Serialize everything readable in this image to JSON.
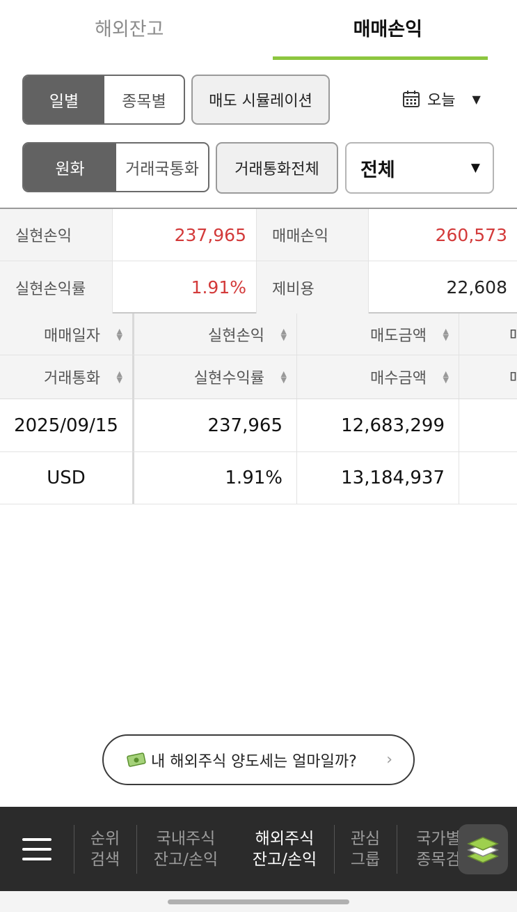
{
  "top_tabs": [
    {
      "label": "해외잔고"
    },
    {
      "label": "매매손익"
    }
  ],
  "period_seg": [
    "일별",
    "종목별"
  ],
  "sell_sim_label": "매도 시뮬레이션",
  "date_label": "오늘",
  "currency_seg": [
    "원화",
    "거래국통화"
  ],
  "all_currency_label": "거래통화전체",
  "dropdown_value": "전체",
  "summary": {
    "realized_pl_label": "실현손익",
    "realized_pl_value": "237,965",
    "trade_pl_label": "매매손익",
    "trade_pl_value": "260,573",
    "realized_rate_label": "실현손익률",
    "realized_rate_value": "1.91%",
    "fees_label": "제비용",
    "fees_value": "22,608"
  },
  "table": {
    "header1": [
      "매매일자",
      "실현손익",
      "매도금액",
      "매"
    ],
    "header2": [
      "거래통화",
      "실현수익률",
      "매수금액",
      "매"
    ],
    "row1": [
      "2025/09/15",
      "237,965",
      "12,683,299"
    ],
    "row2": [
      "USD",
      "1.91%",
      "13,184,937"
    ]
  },
  "promo_text": "내 해외주식 양도세는 얼마일까?",
  "bottom_nav": [
    {
      "line1": "순위",
      "line2": "검색"
    },
    {
      "line1": "국내주식",
      "line2": "잔고/손익"
    },
    {
      "line1": "해외주식",
      "line2": "잔고/손익"
    },
    {
      "line1": "관심",
      "line2": "그룹"
    },
    {
      "line1": "국가별",
      "line2": "종목검"
    }
  ],
  "colors": {
    "accent_green": "#8dc63f",
    "profit_red": "#d33a3a",
    "nav_bg": "#2b2b2b"
  }
}
